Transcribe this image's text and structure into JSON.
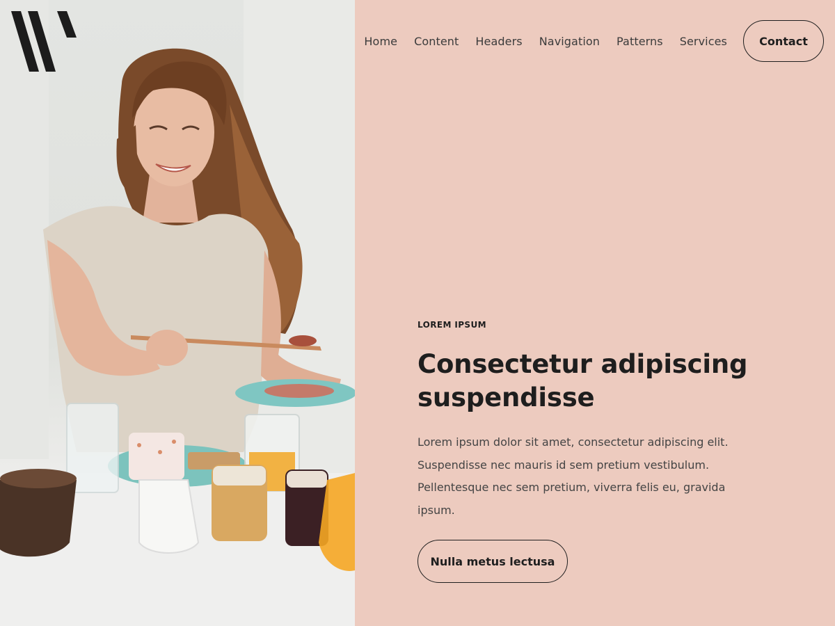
{
  "header": {
    "logo": "site-logo",
    "nav": [
      {
        "label": "Home"
      },
      {
        "label": "Content"
      },
      {
        "label": "Headers"
      },
      {
        "label": "Navigation"
      },
      {
        "label": "Patterns"
      },
      {
        "label": "Services"
      }
    ],
    "contact_label": "Contact"
  },
  "hero": {
    "image_icon": "woman-breakfast-photo",
    "eyebrow": "LOREM IPSUM",
    "headline_line1": "Consectetur adipiscing",
    "headline_line2": "suspendisse",
    "body": "Lorem ipsum dolor sit amet, consectetur adipiscing elit. Suspendisse nec mauris id sem pretium vestibulum. Pellentesque nec sem pretium, viverra felis eu, gravida ipsum.",
    "cta_label": "Nulla metus lectusa"
  },
  "colors": {
    "background": "#edcbbf",
    "text": "#1e1e1e",
    "body_text": "#444444"
  }
}
